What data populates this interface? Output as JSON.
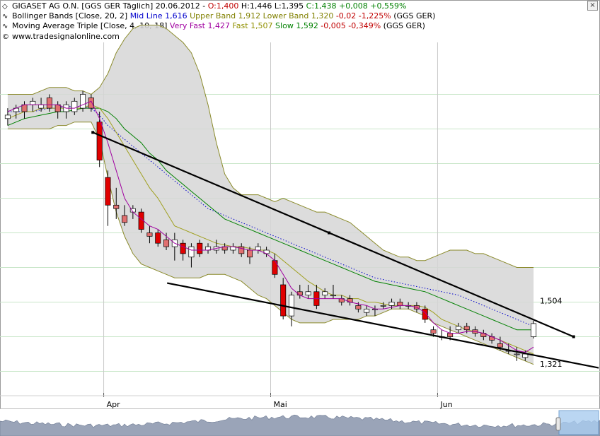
{
  "header": {
    "line1": {
      "name": "GIGASET AG O.N. [GGS GER  Täglich] 20.06.2012 - ",
      "open": "O:1,400",
      "hilo": " H:1,446 L:1,395 ",
      "close": "C:1,438 +0,008 +0,559%"
    },
    "line2": {
      "name": "Bollinger Bands [Close, 20, 2] ",
      "mid": "Mid Line 1,616",
      "upper": " Upper Band 1,912",
      "lower": " Lower Band 1,320",
      "chg": " -0,02 -1,225%",
      "sym": " (GGS GER)"
    },
    "line3": {
      "name": "Moving Average Triple [Close, 4, 10, 18] ",
      "vfast": "Very Fast 1,427",
      "fast": " Fast 1,507",
      "slow": " Slow 1,592",
      "chg": " -0,005 -0,349%",
      "sym": " (GGS GER)"
    },
    "line4": "www.tradesignalonline.com",
    "close_glyph": "×"
  },
  "colors": {
    "up": "#ffffff",
    "down": "#e00000",
    "down_light": "#e07070",
    "band_fill": "#d6d6d6",
    "band_line": "#8a8a2a",
    "mid": "#0000cc",
    "vfast": "#a000a0",
    "fast": "#a0a020",
    "slow": "#008000",
    "grid": "#c8e6c8"
  },
  "chart_data": {
    "type": "candlestick",
    "title": "GIGASET AG O.N. [GGS GER Täglich] 20.06.2012",
    "x_labels": [
      "Apr",
      "Mai",
      "Jun"
    ],
    "y_range": [
      1.25,
      2.25
    ],
    "grid": true,
    "price_labels": [
      "1,504",
      "1,321"
    ],
    "last": {
      "date": "20.06.2012",
      "open": 1.4,
      "high": 1.446,
      "low": 1.395,
      "close": 1.438,
      "change": 0.008,
      "change_pct": 0.559
    },
    "candles": [
      {
        "o": 2.03,
        "h": 2.06,
        "l": 2.01,
        "c": 2.04
      },
      {
        "o": 2.05,
        "h": 2.07,
        "l": 2.03,
        "c": 2.06
      },
      {
        "o": 2.07,
        "h": 2.08,
        "l": 2.03,
        "c": 2.05
      },
      {
        "o": 2.07,
        "h": 2.09,
        "l": 2.05,
        "c": 2.08
      },
      {
        "o": 2.06,
        "h": 2.09,
        "l": 2.05,
        "c": 2.07
      },
      {
        "o": 2.09,
        "h": 2.1,
        "l": 2.05,
        "c": 2.06
      },
      {
        "o": 2.07,
        "h": 2.08,
        "l": 2.03,
        "c": 2.05
      },
      {
        "o": 2.05,
        "h": 2.08,
        "l": 2.03,
        "c": 2.07
      },
      {
        "o": 2.05,
        "h": 2.09,
        "l": 2.04,
        "c": 2.08
      },
      {
        "o": 2.06,
        "h": 2.11,
        "l": 2.05,
        "c": 2.1
      },
      {
        "o": 2.09,
        "h": 2.1,
        "l": 2.05,
        "c": 2.06
      },
      {
        "o": 2.02,
        "h": 2.05,
        "l": 1.89,
        "c": 1.91
      },
      {
        "o": 1.86,
        "h": 1.88,
        "l": 1.72,
        "c": 1.78
      },
      {
        "o": 1.78,
        "h": 1.83,
        "l": 1.74,
        "c": 1.77
      },
      {
        "o": 1.75,
        "h": 1.78,
        "l": 1.72,
        "c": 1.73
      },
      {
        "o": 1.76,
        "h": 1.78,
        "l": 1.74,
        "c": 1.77
      },
      {
        "o": 1.76,
        "h": 1.77,
        "l": 1.7,
        "c": 1.71
      },
      {
        "o": 1.7,
        "h": 1.72,
        "l": 1.67,
        "c": 1.69
      },
      {
        "o": 1.7,
        "h": 1.71,
        "l": 1.66,
        "c": 1.67
      },
      {
        "o": 1.68,
        "h": 1.7,
        "l": 1.65,
        "c": 1.66
      },
      {
        "o": 1.66,
        "h": 1.7,
        "l": 1.62,
        "c": 1.68
      },
      {
        "o": 1.67,
        "h": 1.68,
        "l": 1.62,
        "c": 1.64
      },
      {
        "o": 1.63,
        "h": 1.67,
        "l": 1.6,
        "c": 1.66
      },
      {
        "o": 1.67,
        "h": 1.68,
        "l": 1.63,
        "c": 1.64
      },
      {
        "o": 1.65,
        "h": 1.67,
        "l": 1.64,
        "c": 1.66
      },
      {
        "o": 1.65,
        "h": 1.68,
        "l": 1.64,
        "c": 1.66
      },
      {
        "o": 1.66,
        "h": 1.67,
        "l": 1.64,
        "c": 1.65
      },
      {
        "o": 1.65,
        "h": 1.67,
        "l": 1.64,
        "c": 1.66
      },
      {
        "o": 1.66,
        "h": 1.67,
        "l": 1.63,
        "c": 1.64
      },
      {
        "o": 1.65,
        "h": 1.66,
        "l": 1.61,
        "c": 1.63
      },
      {
        "o": 1.65,
        "h": 1.67,
        "l": 1.64,
        "c": 1.66
      },
      {
        "o": 1.64,
        "h": 1.66,
        "l": 1.63,
        "c": 1.65
      },
      {
        "o": 1.62,
        "h": 1.64,
        "l": 1.57,
        "c": 1.58
      },
      {
        "o": 1.55,
        "h": 1.57,
        "l": 1.45,
        "c": 1.46
      },
      {
        "o": 1.46,
        "h": 1.53,
        "l": 1.43,
        "c": 1.52
      },
      {
        "o": 1.53,
        "h": 1.55,
        "l": 1.51,
        "c": 1.52
      },
      {
        "o": 1.52,
        "h": 1.55,
        "l": 1.51,
        "c": 1.53
      },
      {
        "o": 1.53,
        "h": 1.55,
        "l": 1.48,
        "c": 1.49
      },
      {
        "o": 1.52,
        "h": 1.54,
        "l": 1.51,
        "c": 1.53
      },
      {
        "o": 1.52,
        "h": 1.55,
        "l": 1.51,
        "c": 1.52
      },
      {
        "o": 1.51,
        "h": 1.52,
        "l": 1.49,
        "c": 1.5
      },
      {
        "o": 1.51,
        "h": 1.52,
        "l": 1.49,
        "c": 1.5
      },
      {
        "o": 1.49,
        "h": 1.5,
        "l": 1.47,
        "c": 1.48
      },
      {
        "o": 1.47,
        "h": 1.49,
        "l": 1.46,
        "c": 1.48
      },
      {
        "o": 1.48,
        "h": 1.49,
        "l": 1.46,
        "c": 1.48
      },
      {
        "o": 1.49,
        "h": 1.5,
        "l": 1.48,
        "c": 1.49
      },
      {
        "o": 1.49,
        "h": 1.51,
        "l": 1.48,
        "c": 1.5
      },
      {
        "o": 1.5,
        "h": 1.51,
        "l": 1.48,
        "c": 1.49
      },
      {
        "o": 1.49,
        "h": 1.5,
        "l": 1.48,
        "c": 1.49
      },
      {
        "o": 1.49,
        "h": 1.5,
        "l": 1.47,
        "c": 1.48
      },
      {
        "o": 1.48,
        "h": 1.49,
        "l": 1.44,
        "c": 1.45
      },
      {
        "o": 1.42,
        "h": 1.43,
        "l": 1.4,
        "c": 1.41
      },
      {
        "o": 1.4,
        "h": 1.42,
        "l": 1.39,
        "c": 1.4
      },
      {
        "o": 1.41,
        "h": 1.43,
        "l": 1.39,
        "c": 1.4
      },
      {
        "o": 1.42,
        "h": 1.44,
        "l": 1.41,
        "c": 1.43
      },
      {
        "o": 1.43,
        "h": 1.44,
        "l": 1.41,
        "c": 1.42
      },
      {
        "o": 1.42,
        "h": 1.43,
        "l": 1.4,
        "c": 1.41
      },
      {
        "o": 1.41,
        "h": 1.42,
        "l": 1.39,
        "c": 1.4
      },
      {
        "o": 1.4,
        "h": 1.41,
        "l": 1.38,
        "c": 1.39
      },
      {
        "o": 1.38,
        "h": 1.4,
        "l": 1.36,
        "c": 1.37
      },
      {
        "o": 1.36,
        "h": 1.38,
        "l": 1.35,
        "c": 1.36
      },
      {
        "o": 1.35,
        "h": 1.37,
        "l": 1.33,
        "c": 1.35
      },
      {
        "o": 1.34,
        "h": 1.36,
        "l": 1.33,
        "c": 1.35
      },
      {
        "o": 1.4,
        "h": 1.446,
        "l": 1.395,
        "c": 1.438
      }
    ],
    "series": [
      {
        "name": "Upper Band",
        "values": [
          2.1,
          2.1,
          2.1,
          2.1,
          2.11,
          2.12,
          2.12,
          2.12,
          2.11,
          2.11,
          2.1,
          2.12,
          2.16,
          2.22,
          2.26,
          2.29,
          2.3,
          2.3,
          2.3,
          2.29,
          2.27,
          2.25,
          2.22,
          2.16,
          2.07,
          1.96,
          1.87,
          1.83,
          1.81,
          1.81,
          1.81,
          1.8,
          1.79,
          1.8,
          1.79,
          1.78,
          1.77,
          1.76,
          1.76,
          1.75,
          1.74,
          1.73,
          1.71,
          1.69,
          1.67,
          1.65,
          1.64,
          1.63,
          1.63,
          1.62,
          1.62,
          1.63,
          1.64,
          1.65,
          1.65,
          1.65,
          1.64,
          1.64,
          1.63,
          1.62,
          1.61,
          1.6,
          1.6,
          1.6
        ]
      },
      {
        "name": "Lower Band",
        "values": [
          2.0,
          2.0,
          2.0,
          2.0,
          2.0,
          2.0,
          2.01,
          2.01,
          2.02,
          2.02,
          2.02,
          1.97,
          1.86,
          1.76,
          1.69,
          1.64,
          1.61,
          1.6,
          1.59,
          1.58,
          1.57,
          1.57,
          1.57,
          1.57,
          1.58,
          1.58,
          1.58,
          1.57,
          1.56,
          1.54,
          1.52,
          1.51,
          1.49,
          1.47,
          1.45,
          1.44,
          1.44,
          1.44,
          1.44,
          1.45,
          1.45,
          1.45,
          1.45,
          1.46,
          1.46,
          1.47,
          1.48,
          1.48,
          1.48,
          1.47,
          1.46,
          1.44,
          1.43,
          1.42,
          1.41,
          1.4,
          1.39,
          1.38,
          1.37,
          1.36,
          1.35,
          1.34,
          1.33,
          1.32
        ]
      },
      {
        "name": "Mid Line",
        "values": [
          2.05,
          2.05,
          2.05,
          2.05,
          2.055,
          2.06,
          2.06,
          2.065,
          2.065,
          2.065,
          2.06,
          2.04,
          2.01,
          1.99,
          1.97,
          1.95,
          1.93,
          1.91,
          1.89,
          1.87,
          1.85,
          1.83,
          1.81,
          1.79,
          1.77,
          1.76,
          1.75,
          1.74,
          1.73,
          1.72,
          1.71,
          1.7,
          1.69,
          1.68,
          1.67,
          1.66,
          1.65,
          1.64,
          1.63,
          1.62,
          1.61,
          1.6,
          1.59,
          1.58,
          1.57,
          1.565,
          1.56,
          1.555,
          1.55,
          1.545,
          1.54,
          1.535,
          1.53,
          1.525,
          1.52,
          1.51,
          1.5,
          1.49,
          1.48,
          1.47,
          1.46,
          1.45,
          1.44,
          1.43
        ]
      },
      {
        "name": "Very Fast",
        "values": [
          2.05,
          2.06,
          2.07,
          2.07,
          2.07,
          2.07,
          2.07,
          2.06,
          2.06,
          2.07,
          2.08,
          2.03,
          1.96,
          1.88,
          1.8,
          1.76,
          1.74,
          1.72,
          1.71,
          1.69,
          1.67,
          1.66,
          1.65,
          1.65,
          1.65,
          1.655,
          1.66,
          1.66,
          1.655,
          1.65,
          1.65,
          1.64,
          1.62,
          1.58,
          1.54,
          1.52,
          1.51,
          1.51,
          1.51,
          1.51,
          1.51,
          1.5,
          1.495,
          1.49,
          1.48,
          1.48,
          1.485,
          1.49,
          1.49,
          1.485,
          1.47,
          1.44,
          1.42,
          1.41,
          1.41,
          1.415,
          1.415,
          1.41,
          1.4,
          1.39,
          1.375,
          1.36,
          1.355,
          1.37
        ]
      },
      {
        "name": "Fast",
        "values": [
          2.03,
          2.04,
          2.05,
          2.05,
          2.06,
          2.06,
          2.06,
          2.06,
          2.06,
          2.06,
          2.07,
          2.06,
          2.03,
          1.99,
          1.95,
          1.91,
          1.87,
          1.83,
          1.8,
          1.76,
          1.72,
          1.71,
          1.7,
          1.69,
          1.68,
          1.67,
          1.665,
          1.66,
          1.66,
          1.655,
          1.65,
          1.65,
          1.64,
          1.62,
          1.6,
          1.58,
          1.56,
          1.545,
          1.53,
          1.52,
          1.52,
          1.51,
          1.51,
          1.5,
          1.5,
          1.495,
          1.49,
          1.49,
          1.49,
          1.49,
          1.485,
          1.47,
          1.45,
          1.44,
          1.43,
          1.42,
          1.415,
          1.41,
          1.4,
          1.39,
          1.38,
          1.37,
          1.36,
          1.35
        ]
      },
      {
        "name": "Slow",
        "values": [
          2.01,
          2.02,
          2.03,
          2.035,
          2.04,
          2.045,
          2.05,
          2.05,
          2.055,
          2.06,
          2.06,
          2.06,
          2.05,
          2.03,
          2.0,
          1.98,
          1.96,
          1.93,
          1.91,
          1.88,
          1.86,
          1.84,
          1.82,
          1.8,
          1.78,
          1.76,
          1.74,
          1.73,
          1.72,
          1.71,
          1.7,
          1.69,
          1.68,
          1.67,
          1.66,
          1.65,
          1.64,
          1.63,
          1.62,
          1.61,
          1.6,
          1.59,
          1.58,
          1.57,
          1.56,
          1.555,
          1.55,
          1.545,
          1.54,
          1.535,
          1.53,
          1.52,
          1.51,
          1.5,
          1.49,
          1.48,
          1.47,
          1.46,
          1.45,
          1.44,
          1.43,
          1.42,
          1.42,
          1.42
        ]
      }
    ]
  }
}
